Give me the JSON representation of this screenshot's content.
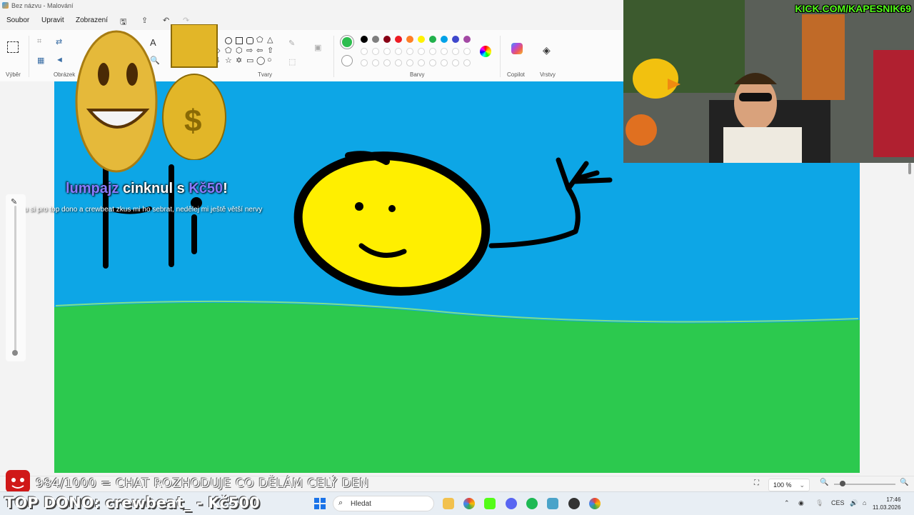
{
  "window": {
    "title": "Bez názvu - Malování"
  },
  "menu": {
    "items": [
      "Soubor",
      "Upravit",
      "Zobrazení"
    ]
  },
  "ribbon": {
    "groups": {
      "select": "Výběr",
      "image": "Obrázek",
      "shapes": "Tvary",
      "colors": "Barvy",
      "copilot": "Copilot",
      "layers": "Vrstvy"
    },
    "text_tool": "A",
    "active_color": "#2dbd4e",
    "palette_row1": [
      "#000000",
      "#7f7f7f",
      "#880015",
      "#ed1c24",
      "#ff7f27",
      "#fff200",
      "#22b14c",
      "#00a2e8",
      "#3f48cc",
      "#a349a4"
    ],
    "palette_row2": [
      "#ffffff",
      "#c3c3c3",
      "#b97a57",
      "#ffaec9",
      "#ffc90e",
      "#efe4b0",
      "#b5e61d",
      "#99d9ea",
      "#7092be",
      "#c8bfe7"
    ]
  },
  "stream": {
    "channel": "KICK.COM/KAPESNIK69",
    "alert_user": "lumpajz",
    "alert_text": " cinknul s ",
    "alert_amount": "Kč50",
    "alert_excl": "!",
    "alert_message": "jdu si pro top dono a crewbeat zkus mi ho sebrat, nedělej mi ještě větší nervy",
    "goal": "984/1000 = CHAT ROZHODUJE CO DĚLÁM CELÝ DEN",
    "top_dono": "TOP DONO: crewbeat_ - Kč500"
  },
  "status": {
    "zoom": "100 %"
  },
  "taskbar": {
    "search_placeholder": "Hledat",
    "language": "CES",
    "time": "17:46",
    "date": "11.03.2026"
  },
  "colors": {
    "canvas_sky": "#0da6e6",
    "grass": "#2cc94e",
    "sun_yellow": "#ffef00"
  }
}
